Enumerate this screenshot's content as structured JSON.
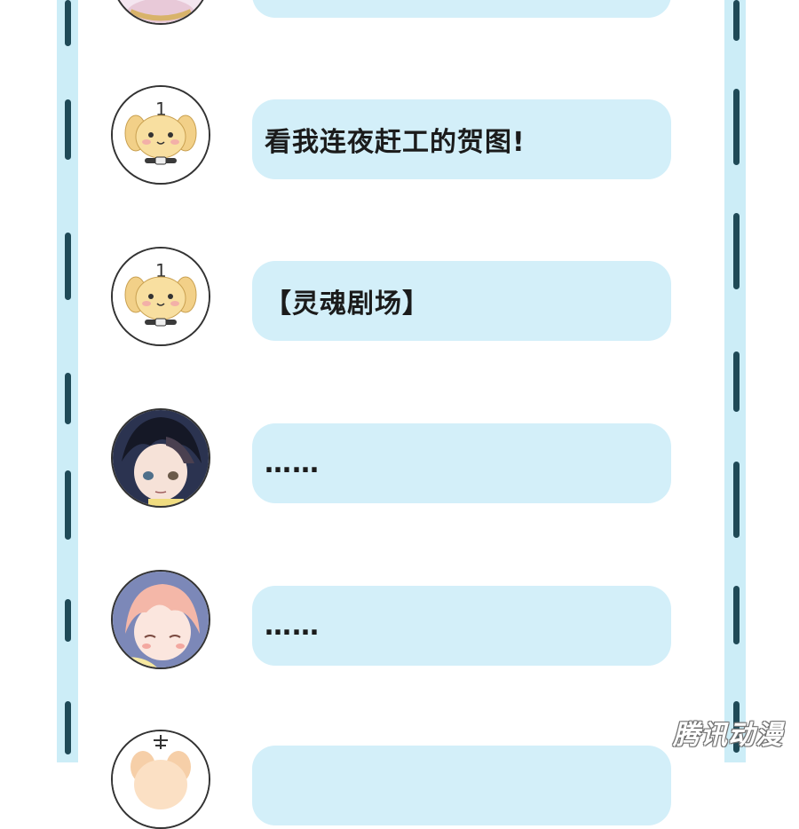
{
  "messages": [
    {
      "avatar": "dog-avatar",
      "badge": "1",
      "text": "看我连夜赶工的贺图!"
    },
    {
      "avatar": "dog-avatar",
      "badge": "1",
      "text": "【灵魂剧场】"
    },
    {
      "avatar": "dark-hair-boy-avatar",
      "text": "……"
    },
    {
      "avatar": "pink-hair-boy-avatar",
      "text": "……"
    }
  ],
  "watermark": "腾讯动漫",
  "colors": {
    "border": "#ccedf7",
    "dash": "#1f4a57",
    "bubble": "#d3eff9",
    "text": "#1b1b1b"
  }
}
